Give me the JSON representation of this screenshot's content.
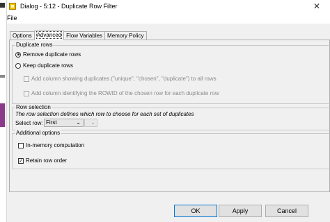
{
  "window": {
    "title": "Dialog - 5:12 - Duplicate Row Filter",
    "close_glyph": "✕"
  },
  "menu": {
    "file": "File"
  },
  "tabs": [
    {
      "label": "Options"
    },
    {
      "label": "Advanced"
    },
    {
      "label": "Flow Variables"
    },
    {
      "label": "Memory Policy"
    }
  ],
  "duplicate_rows": {
    "title": "Duplicate rows",
    "remove_label": "Remove duplicate rows",
    "keep_label": "Keep duplicate rows",
    "add_column_label": "Add column showing duplicates (\"unique\", \"chosen\", \"duplicate\") to all rows",
    "add_rowid_label": "Add column identifying the ROWID of the chosen row for each duplicate row"
  },
  "row_selection": {
    "title": "Row selection",
    "description": "The row selection defines which row to choose for each set of duplicates",
    "select_label": "Select row:",
    "select_value": "First"
  },
  "additional": {
    "title": "Additional options",
    "in_memory_label": "In-memory computation",
    "retain_order_label": "Retain row order"
  },
  "buttons": {
    "ok": "OK",
    "apply": "Apply",
    "cancel": "Cancel"
  }
}
